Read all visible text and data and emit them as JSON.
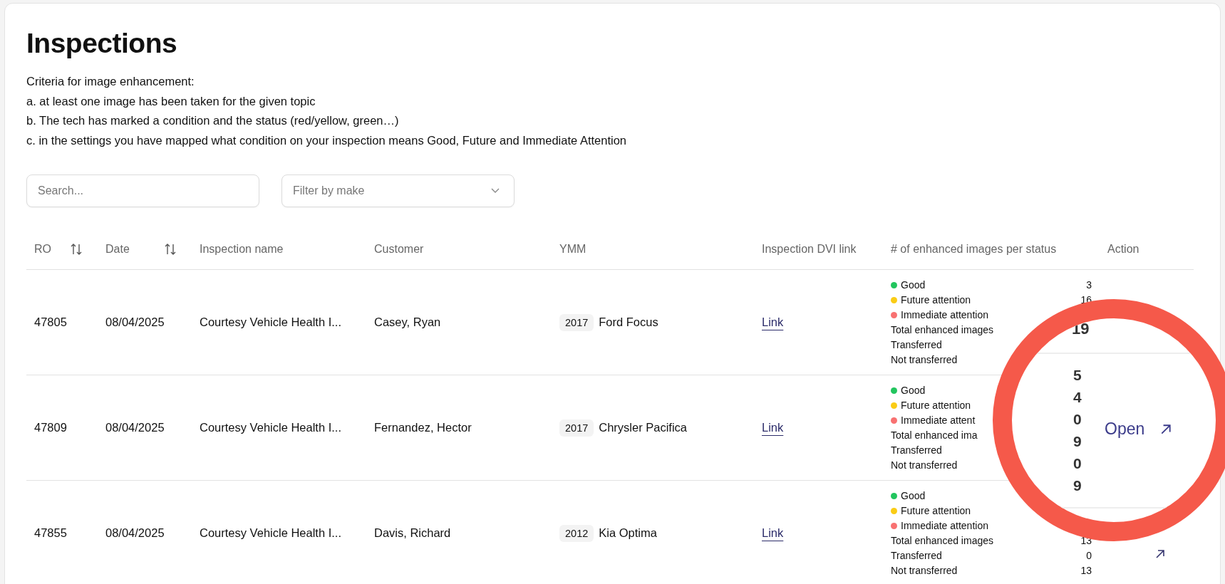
{
  "title": "Inspections",
  "criteria": [
    "Criteria for image enhancement:",
    "a. at least one image has been taken for the given topic",
    "b. The tech has marked a condition and the status (red/yellow, green…)",
    "c. in the settings you have mapped what condition on your inspection means Good, Future and Immediate Attention"
  ],
  "search": {
    "placeholder": "Search..."
  },
  "filter": {
    "placeholder": "Filter by make"
  },
  "table": {
    "columns": [
      {
        "label": "RO",
        "sortable": true
      },
      {
        "label": "Date",
        "sortable": true
      },
      {
        "label": "Inspection name",
        "sortable": false
      },
      {
        "label": "Customer",
        "sortable": false
      },
      {
        "label": "YMM",
        "sortable": false
      },
      {
        "label": "Inspection DVI link",
        "sortable": false
      },
      {
        "label": "# of enhanced images per status",
        "sortable": false
      },
      {
        "label": "Action",
        "sortable": false
      }
    ],
    "rows": [
      {
        "ro": "47805",
        "date": "08/04/2025",
        "inspection": "Courtesy Vehicle Health I...",
        "customer": "Casey, Ryan",
        "year": "2017",
        "model": "Ford Focus",
        "link": "Link",
        "action_arrow": false,
        "stats": [
          {
            "label": "Good",
            "color": "#22c55e",
            "value": "3"
          },
          {
            "label": "Future attention",
            "color": "#facc15",
            "value": "16"
          },
          {
            "label": "Immediate attention",
            "color": "#f87171"
          },
          {
            "label": "Total enhanced images"
          },
          {
            "label": "Transferred"
          },
          {
            "label": "Not transferred"
          }
        ]
      },
      {
        "ro": "47809",
        "date": "08/04/2025",
        "inspection": "Courtesy Vehicle Health I...",
        "customer": "Fernandez, Hector",
        "year": "2017",
        "model": "Chrysler Pacifica",
        "link": "Link",
        "action_arrow": false,
        "stats": [
          {
            "label": "Good",
            "color": "#22c55e"
          },
          {
            "label": "Future attention",
            "color": "#facc15"
          },
          {
            "label": "Immediate attent",
            "color": "#f87171"
          },
          {
            "label": "Total enhanced ima"
          },
          {
            "label": "Transferred"
          },
          {
            "label": "Not transferred"
          }
        ]
      },
      {
        "ro": "47855",
        "date": "08/04/2025",
        "inspection": "Courtesy Vehicle Health I...",
        "customer": "Davis, Richard",
        "year": "2012",
        "model": "Kia Optima",
        "link": "Link",
        "action_arrow": true,
        "stats": [
          {
            "label": "Good",
            "color": "#22c55e"
          },
          {
            "label": "Future attention",
            "color": "#facc15"
          },
          {
            "label": "Immediate attention",
            "color": "#f87171"
          },
          {
            "label": "Total enhanced images",
            "value": "13"
          },
          {
            "label": "Transferred",
            "value": "0"
          },
          {
            "label": "Not transferred",
            "value": "13"
          }
        ]
      }
    ]
  },
  "magnifier": {
    "top_value": "19",
    "values": [
      "5",
      "4",
      "0",
      "9",
      "0",
      "9"
    ],
    "action": "Open"
  }
}
